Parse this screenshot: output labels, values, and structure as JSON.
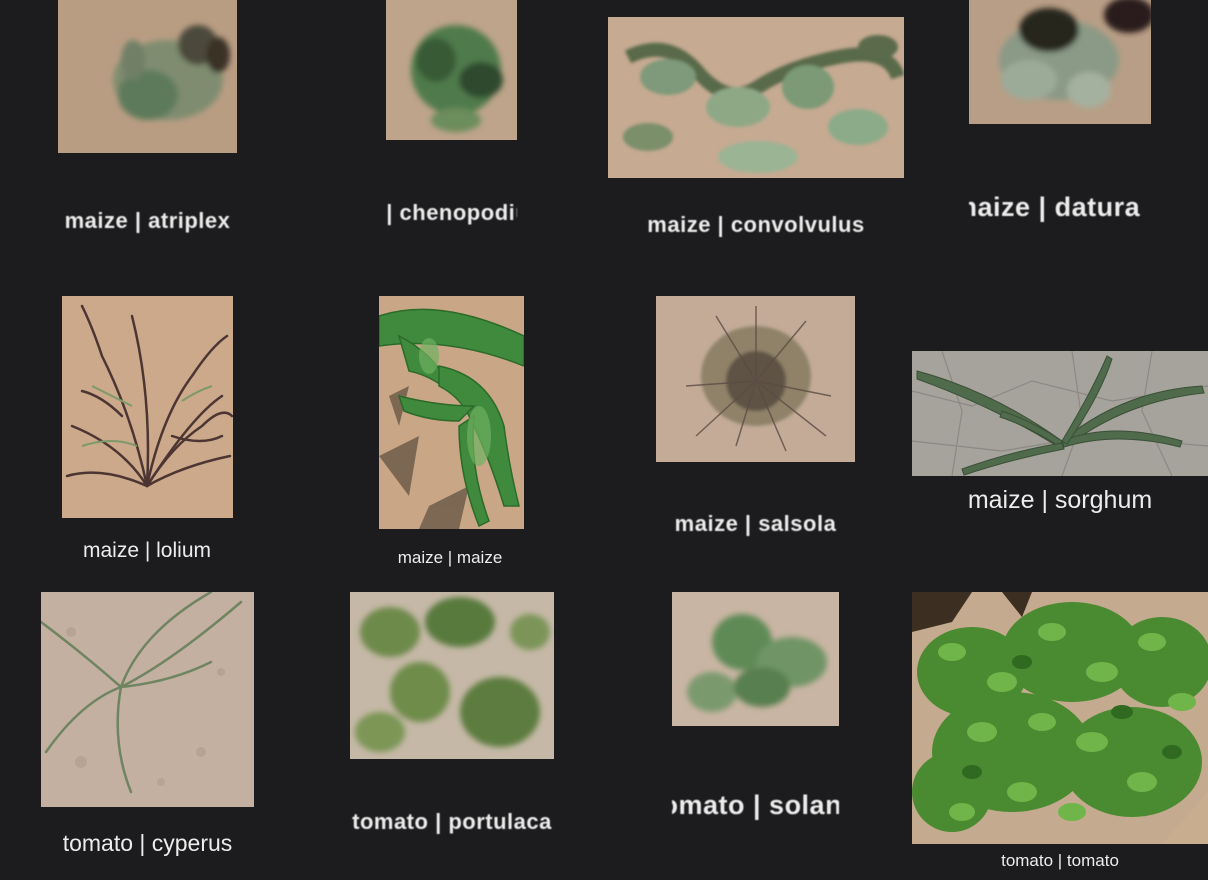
{
  "grid": {
    "row1": [
      {
        "label": "maize | atriplex"
      },
      {
        "label": "maize | chenopodium"
      },
      {
        "label": "maize | convolvulus"
      },
      {
        "label": "maize | datura"
      }
    ],
    "row2": [
      {
        "label": "maize | lolium"
      },
      {
        "label": "maize | maize"
      },
      {
        "label": "maize | salsola"
      },
      {
        "label": "maize | sorghum"
      }
    ],
    "row3": [
      {
        "label": "tomato | cyperus"
      },
      {
        "label": "tomato | portulaca"
      },
      {
        "label": "tomato | solanum"
      },
      {
        "label": "tomato | tomato"
      }
    ]
  }
}
